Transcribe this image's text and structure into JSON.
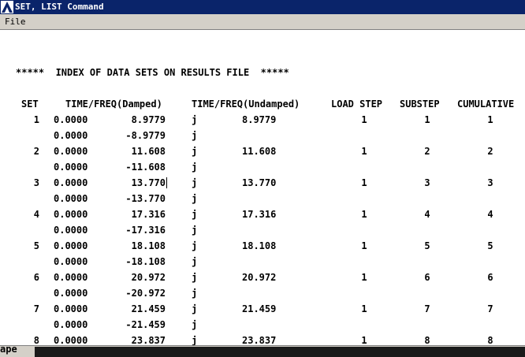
{
  "window": {
    "title": "SET, LIST Command",
    "app_icon": "ansys-icon"
  },
  "menu": {
    "file_label": "File"
  },
  "header_line": "*****  INDEX OF DATA SETS ON RESULTS FILE  *****",
  "columns": {
    "set": "SET",
    "damped": "TIME/FREQ(Damped)",
    "undamped": "TIME/FREQ(Undamped)",
    "load_step": "LOAD STEP",
    "substep": "SUBSTEP",
    "cumulative": "CUMULATIVE"
  },
  "rows": [
    {
      "set": "1",
      "real": "0.0000",
      "damped": "8.9779",
      "j": "j",
      "undamped": "8.9779",
      "load_step": "1",
      "substep": "1",
      "cumulative": "1"
    },
    {
      "set": "",
      "real": "0.0000",
      "damped": "-8.9779",
      "j": "j",
      "undamped": "",
      "load_step": "",
      "substep": "",
      "cumulative": ""
    },
    {
      "set": "2",
      "real": "0.0000",
      "damped": "11.608",
      "j": "j",
      "undamped": "11.608",
      "load_step": "1",
      "substep": "2",
      "cumulative": "2"
    },
    {
      "set": "",
      "real": "0.0000",
      "damped": "-11.608",
      "j": "j",
      "undamped": "",
      "load_step": "",
      "substep": "",
      "cumulative": ""
    },
    {
      "set": "3",
      "real": "0.0000",
      "damped": "13.770",
      "j": "j",
      "undamped": "13.770",
      "load_step": "1",
      "substep": "3",
      "cumulative": "3"
    },
    {
      "set": "",
      "real": "0.0000",
      "damped": "-13.770",
      "j": "j",
      "undamped": "",
      "load_step": "",
      "substep": "",
      "cumulative": ""
    },
    {
      "set": "4",
      "real": "0.0000",
      "damped": "17.316",
      "j": "j",
      "undamped": "17.316",
      "load_step": "1",
      "substep": "4",
      "cumulative": "4"
    },
    {
      "set": "",
      "real": "0.0000",
      "damped": "-17.316",
      "j": "j",
      "undamped": "",
      "load_step": "",
      "substep": "",
      "cumulative": ""
    },
    {
      "set": "5",
      "real": "0.0000",
      "damped": "18.108",
      "j": "j",
      "undamped": "18.108",
      "load_step": "1",
      "substep": "5",
      "cumulative": "5"
    },
    {
      "set": "",
      "real": "0.0000",
      "damped": "-18.108",
      "j": "j",
      "undamped": "",
      "load_step": "",
      "substep": "",
      "cumulative": ""
    },
    {
      "set": "6",
      "real": "0.0000",
      "damped": "20.972",
      "j": "j",
      "undamped": "20.972",
      "load_step": "1",
      "substep": "6",
      "cumulative": "6"
    },
    {
      "set": "",
      "real": "0.0000",
      "damped": "-20.972",
      "j": "j",
      "undamped": "",
      "load_step": "",
      "substep": "",
      "cumulative": ""
    },
    {
      "set": "7",
      "real": "0.0000",
      "damped": "21.459",
      "j": "j",
      "undamped": "21.459",
      "load_step": "1",
      "substep": "7",
      "cumulative": "7"
    },
    {
      "set": "",
      "real": "0.0000",
      "damped": "-21.459",
      "j": "j",
      "undamped": "",
      "load_step": "",
      "substep": "",
      "cumulative": ""
    },
    {
      "set": "8",
      "real": "0.0000",
      "damped": "23.837",
      "j": "j",
      "undamped": "23.837",
      "load_step": "1",
      "substep": "8",
      "cumulative": "8"
    }
  ],
  "taskbar": {
    "partial_text": "ape"
  }
}
